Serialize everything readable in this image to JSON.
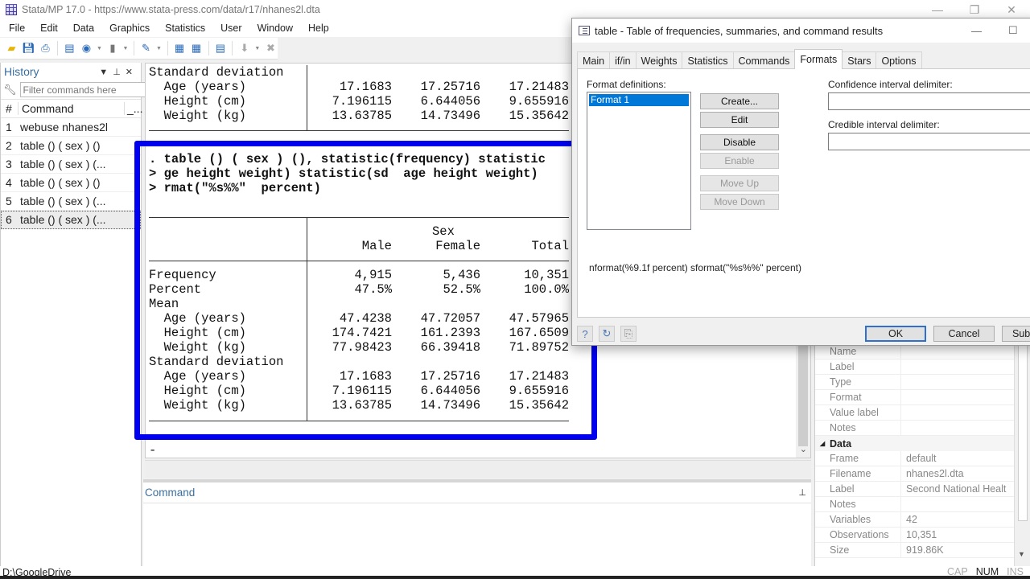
{
  "window": {
    "title": "Stata/MP 17.0 - https://www.stata-press.com/data/r17/nhanes2l.dta",
    "controls": [
      "minimize",
      "restore",
      "close"
    ]
  },
  "menu": [
    "File",
    "Edit",
    "Data",
    "Graphics",
    "Statistics",
    "User",
    "Window",
    "Help"
  ],
  "toolbar": {
    "icons": [
      "open-icon",
      "save-icon",
      "print-icon",
      "log-icon",
      "viewer-icon",
      "graph-icon",
      "do-file-editor-icon",
      "data-editor-icon",
      "data-browser-icon",
      "variables-manager-icon",
      "more-icon",
      "break-icon"
    ]
  },
  "history": {
    "title": "History",
    "filter_placeholder": "Filter commands here",
    "columns": [
      "#",
      "Command",
      "_..."
    ],
    "items": [
      {
        "n": "1",
        "cmd": "webuse nhanes2l"
      },
      {
        "n": "2",
        "cmd": "table () ( sex ) ()"
      },
      {
        "n": "3",
        "cmd": "table () ( sex ) (..."
      },
      {
        "n": "4",
        "cmd": "table () ( sex ) ()"
      },
      {
        "n": "5",
        "cmd": "table () ( sex ) (..."
      },
      {
        "n": "6",
        "cmd": "table () ( sex ) (..."
      }
    ],
    "selected_index": 5
  },
  "results": {
    "prev_table": {
      "section": "Standard deviation",
      "rows": [
        {
          "label": "  Age (years)",
          "male": "17.1683",
          "female": "17.25716",
          "total": "17.21483"
        },
        {
          "label": "  Height (cm)",
          "male": "7.196115",
          "female": "6.644056",
          "total": "9.655916"
        },
        {
          "label": "  Weight (kg)",
          "male": "13.63785",
          "female": "14.73496",
          "total": "15.35642"
        }
      ]
    },
    "command_lines": [
      ". table () ( sex ) (), statistic(frequency) statistic",
      "> ge height weight) statistic(sd  age height weight)",
      "> rmat(\"%s%%\"  percent)"
    ],
    "table": {
      "header_group": "Sex",
      "columns": [
        "Male",
        "Female",
        "Total"
      ],
      "rows": [
        {
          "label": "Frequency",
          "male": "4,915",
          "female": "5,436",
          "total": "10,351"
        },
        {
          "label": "Percent",
          "male": "47.5%",
          "female": "52.5%",
          "total": "100.0%"
        },
        {
          "label": "Mean",
          "male": "",
          "female": "",
          "total": ""
        },
        {
          "label": "  Age (years)",
          "male": "47.4238",
          "female": "47.72057",
          "total": "47.57965"
        },
        {
          "label": "  Height (cm)",
          "male": "174.7421",
          "female": "161.2393",
          "total": "167.6509"
        },
        {
          "label": "  Weight (kg)",
          "male": "77.98423",
          "female": "66.39418",
          "total": "71.89752"
        },
        {
          "label": "Standard deviation",
          "male": "",
          "female": "",
          "total": ""
        },
        {
          "label": "  Age (years)",
          "male": "17.1683",
          "female": "17.25716",
          "total": "17.21483"
        },
        {
          "label": "  Height (cm)",
          "male": "7.196115",
          "female": "6.644056",
          "total": "9.655916"
        },
        {
          "label": "  Weight (kg)",
          "male": "13.63785",
          "female": "14.73496",
          "total": "15.35642"
        }
      ]
    },
    "prompt": "-",
    "highlight_color": "#0000ee"
  },
  "command_window": {
    "title": "Command",
    "value": ""
  },
  "properties": {
    "variable_rows": [
      {
        "k": "Name",
        "v": ""
      },
      {
        "k": "Label",
        "v": ""
      },
      {
        "k": "Type",
        "v": ""
      },
      {
        "k": "Format",
        "v": ""
      },
      {
        "k": "Value label",
        "v": ""
      },
      {
        "k": "Notes",
        "v": ""
      }
    ],
    "data_section": "Data",
    "data_rows": [
      {
        "k": "Frame",
        "v": "default"
      },
      {
        "k": "Filename",
        "v": "nhanes2l.dta"
      },
      {
        "k": "Label",
        "v": "Second National Healt"
      },
      {
        "k": "Notes",
        "v": ""
      },
      {
        "k": "Variables",
        "v": "42"
      },
      {
        "k": "Observations",
        "v": "10,351"
      },
      {
        "k": "Size",
        "v": "919.86K"
      }
    ]
  },
  "dialog": {
    "title": "table - Table of frequencies, summaries, and command results",
    "tabs": [
      "Main",
      "if/in",
      "Weights",
      "Statistics",
      "Commands",
      "Formats",
      "Stars",
      "Options"
    ],
    "active_tab": "Formats",
    "format_definitions_label": "Format definitions:",
    "format_items": [
      "Format 1"
    ],
    "buttons": {
      "create": "Create...",
      "edit": "Edit",
      "disable": "Disable",
      "enable": "Enable",
      "move_up": "Move Up",
      "move_down": "Move Down"
    },
    "ci_delimiter_label": "Confidence interval delimiter:",
    "ci_delimiter_value": "",
    "credible_delimiter_label": "Credible interval delimiter:",
    "credible_delimiter_value": "",
    "format_command": "nformat(%9.1f  percent) sformat(\"%s%%\"  percent)",
    "footer": {
      "ok": "OK",
      "cancel": "Cancel",
      "submit": "Sub"
    }
  },
  "statusbar": {
    "path": "D:\\GoogleDrive",
    "indicators": [
      {
        "label": "CAP",
        "active": false
      },
      {
        "label": "NUM",
        "active": true
      },
      {
        "label": "INS",
        "active": false
      }
    ]
  }
}
